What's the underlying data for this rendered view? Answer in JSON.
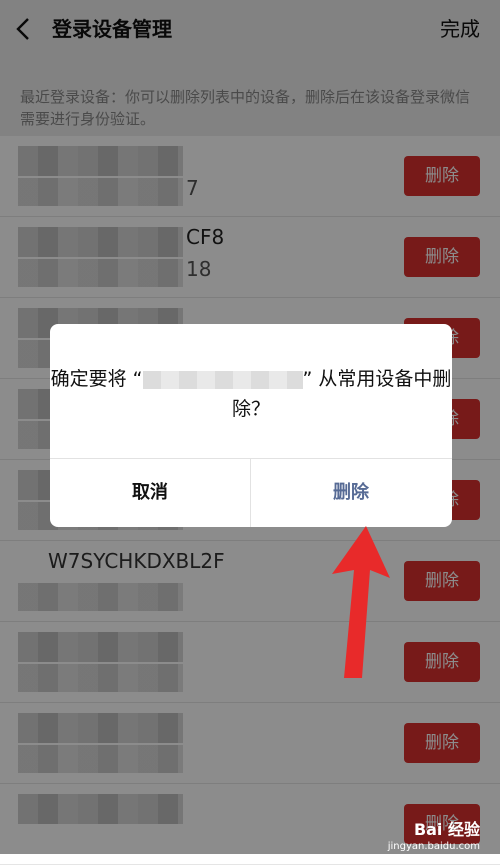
{
  "header": {
    "title": "登录设备管理",
    "done_label": "完成"
  },
  "description": "最近登录设备：你可以删除列表中的设备，删除后在该设备登录微信需要进行身份验证。",
  "device_rows": [
    {
      "suffix1": "",
      "suffix2": "7",
      "delete_label": "删除"
    },
    {
      "suffix1": "CF8",
      "suffix2": "18",
      "delete_label": "删除"
    },
    {
      "suffix1": "",
      "suffix2": "",
      "delete_label": "删除"
    },
    {
      "suffix1": "",
      "suffix2": "",
      "delete_label": "删除"
    },
    {
      "suffix1": "",
      "suffix2": "",
      "delete_label": "删除"
    },
    {
      "suffix1": "W7SYCHKDXBL2F",
      "suffix2": "",
      "delete_label": "删除"
    },
    {
      "suffix1": "",
      "suffix2": "",
      "delete_label": "删除"
    },
    {
      "suffix1": "",
      "suffix2": "",
      "delete_label": "删除"
    },
    {
      "suffix1": "",
      "suffix2": "",
      "delete_label": "删除"
    }
  ],
  "dialog": {
    "message_prefix": "确定要将 “",
    "message_suffix": "” 从常用设备中删除？",
    "cancel_label": "取消",
    "confirm_label": "删除"
  },
  "watermark": {
    "text": "Bai 经验",
    "sub": "jingyan.baidu.com"
  },
  "colors": {
    "delete_button": "#d9312f",
    "confirm_text": "#576b95",
    "arrow": "#e82a2a"
  }
}
